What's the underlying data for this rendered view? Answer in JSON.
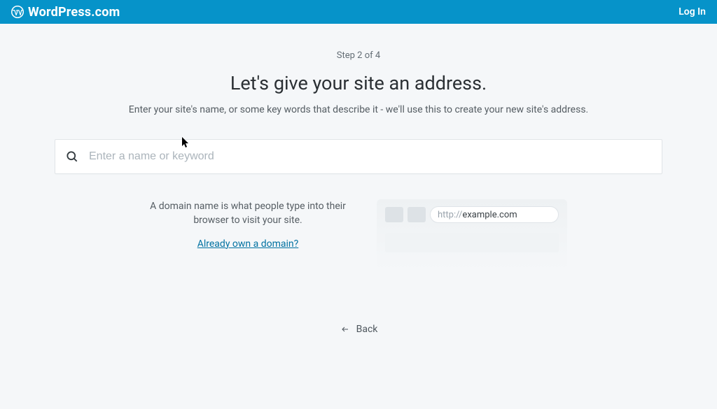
{
  "header": {
    "brand": "WordPress.com",
    "login": "Log In"
  },
  "step": "Step 2 of 4",
  "headline": "Let's give your site an address.",
  "subtitle": "Enter your site's name, or some key words that describe it - we'll use this to create your new site's address.",
  "search": {
    "placeholder": "Enter a name or keyword",
    "value": ""
  },
  "info": {
    "description": "A domain name is what people type into their browser to visit your site.",
    "own_domain_link": "Already own a domain?"
  },
  "browser_mock": {
    "protocol": "http://",
    "domain": "example.com"
  },
  "back": "Back"
}
